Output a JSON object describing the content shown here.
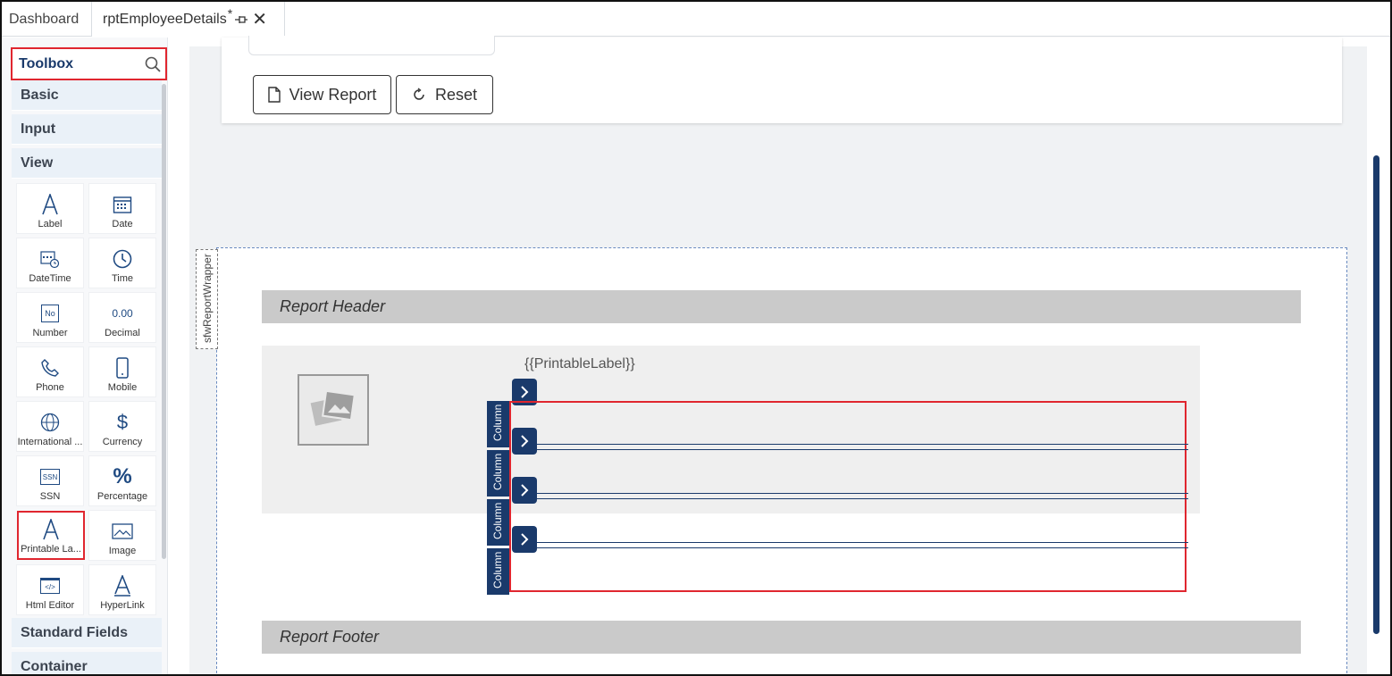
{
  "tabs": [
    {
      "label": "Dashboard"
    },
    {
      "label": "rptEmployeeDetails",
      "modified_marker": "*"
    }
  ],
  "toolbox": {
    "title": "Toolbox",
    "sections": [
      "Basic",
      "Input",
      "View",
      "Standard Fields",
      "Container"
    ],
    "view_tools": [
      {
        "label": "Label",
        "icon": "label-a-icon"
      },
      {
        "label": "Date",
        "icon": "calendar-icon"
      },
      {
        "label": "DateTime",
        "icon": "calendar-clock-icon"
      },
      {
        "label": "Time",
        "icon": "clock-icon"
      },
      {
        "label": "Number",
        "icon": "number-box-icon",
        "glyph": "No"
      },
      {
        "label": "Decimal",
        "icon": "decimal-icon",
        "glyph": "0.00"
      },
      {
        "label": "Phone",
        "icon": "phone-icon"
      },
      {
        "label": "Mobile",
        "icon": "mobile-icon"
      },
      {
        "label": "International ...",
        "icon": "globe-phone-icon"
      },
      {
        "label": "Currency",
        "icon": "dollar-icon",
        "glyph": "$"
      },
      {
        "label": "SSN",
        "icon": "ssn-box-icon",
        "glyph": "SSN"
      },
      {
        "label": "Percentage",
        "icon": "percent-icon",
        "glyph": "%"
      },
      {
        "label": "Printable La...",
        "icon": "label-a-icon"
      },
      {
        "label": "Image",
        "icon": "image-icon"
      },
      {
        "label": "Html Editor",
        "icon": "code-window-icon",
        "glyph": "</>"
      },
      {
        "label": "HyperLink",
        "icon": "hyperlink-a-icon"
      }
    ]
  },
  "filter": {
    "view_report_label": "View Report",
    "reset_label": "Reset"
  },
  "report": {
    "wrapper_label": "sfwReportWrapper",
    "header_label": "Report Header",
    "footer_label": "Report Footer",
    "printable_placeholder": "{{PrintableLabel}}",
    "column_label": "Column"
  },
  "colors": {
    "accent": "#1a3a6b",
    "highlight": "#e0262f"
  }
}
